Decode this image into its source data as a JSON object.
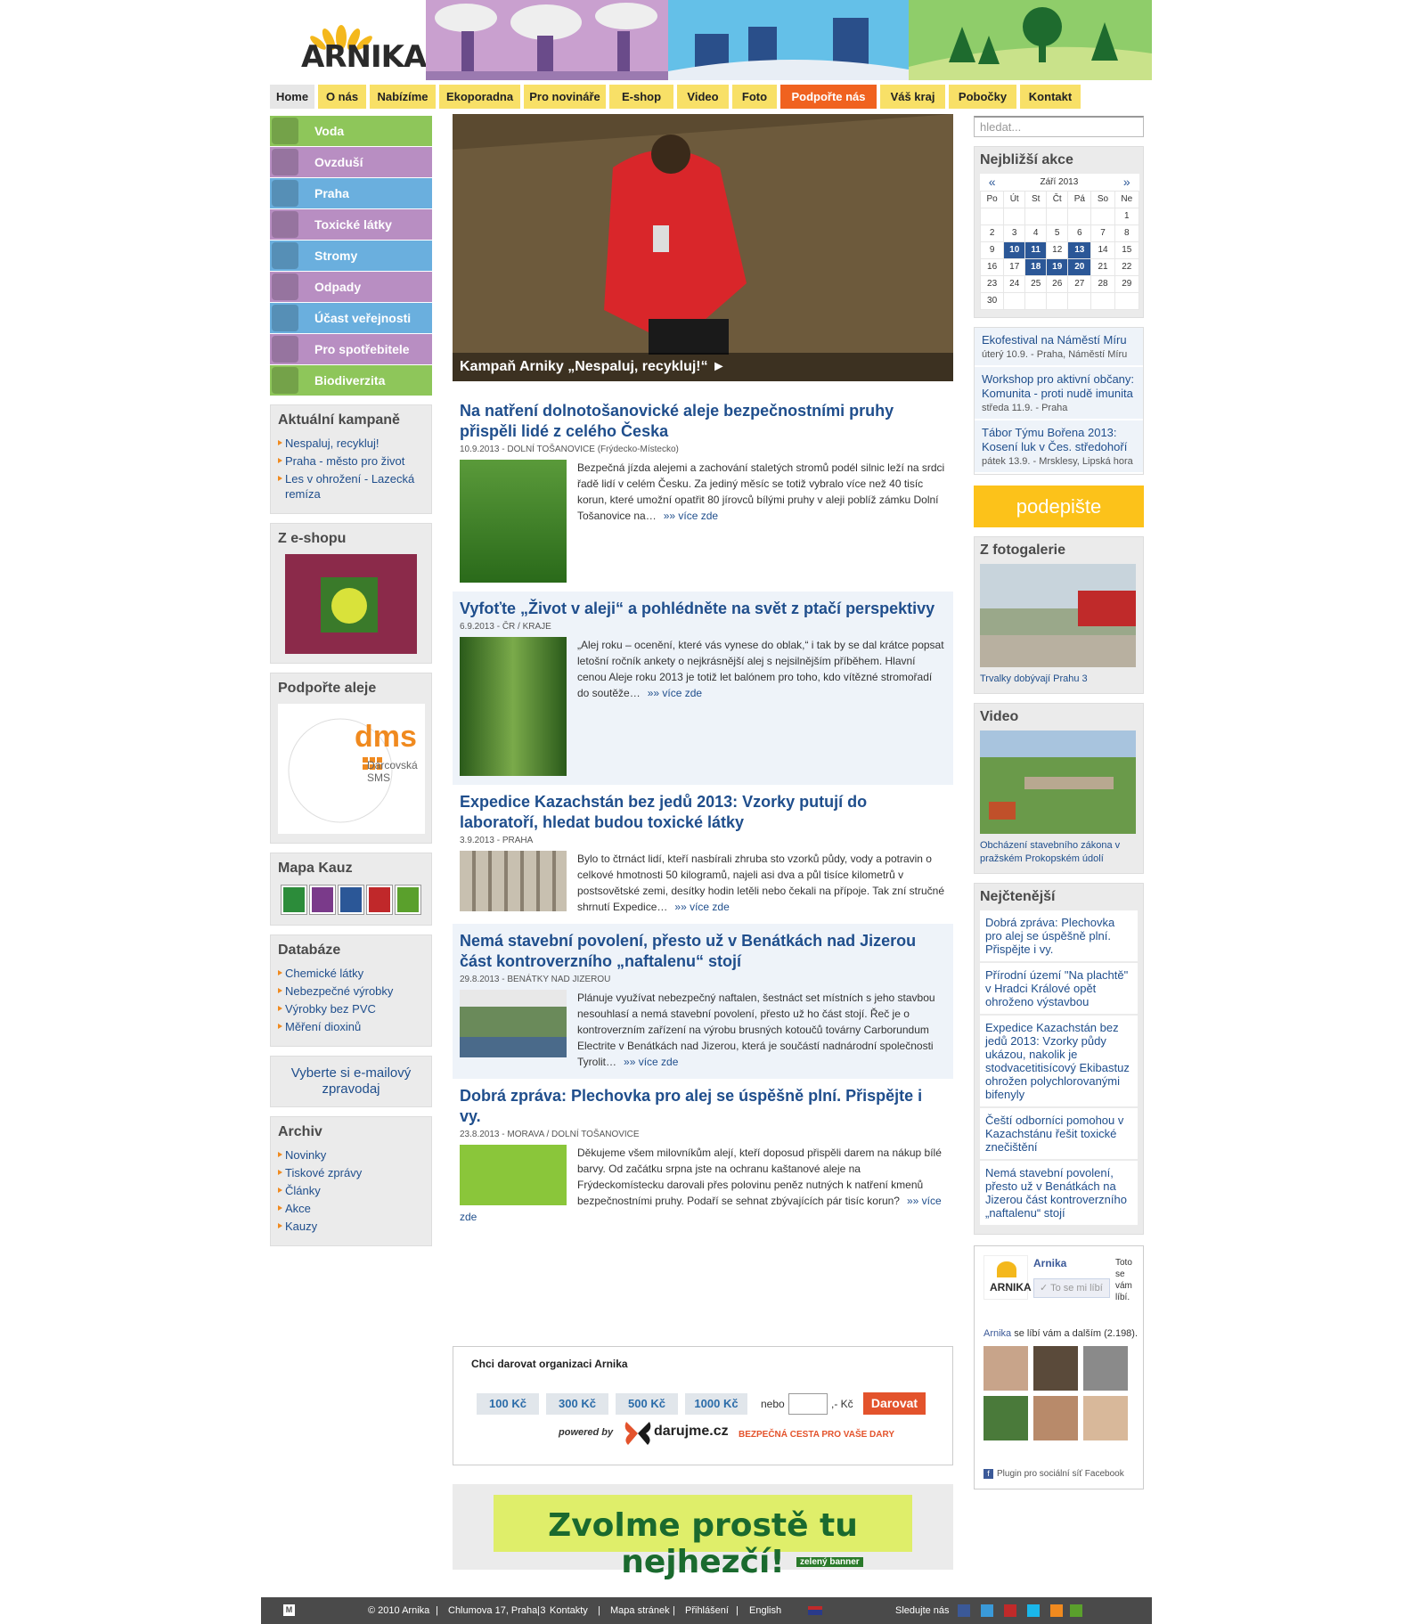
{
  "logo": {
    "text": "ARNIKA"
  },
  "nav": [
    "Home",
    "O nás",
    "Nabízíme",
    "Ekoporadna",
    "Pro novináře",
    "E-shop",
    "Video",
    "Foto",
    "Podpořte nás",
    "Váš kraj",
    "Pobočky",
    "Kontakt"
  ],
  "categories": [
    {
      "label": "Voda",
      "color": "#8ec65a",
      "icon": "water-icon"
    },
    {
      "label": "Ovzduší",
      "color": "#b88ec2",
      "icon": "chimney-icon"
    },
    {
      "label": "Praha",
      "color": "#6aafde",
      "icon": "city-icon"
    },
    {
      "label": "Toxické látky",
      "color": "#b88ec2",
      "icon": "toxic-icon"
    },
    {
      "label": "Stromy",
      "color": "#6aafde",
      "icon": "tree-icon"
    },
    {
      "label": "Odpady",
      "color": "#b88ec2",
      "icon": "recycle-icon"
    },
    {
      "label": "Účast veřejnosti",
      "color": "#6aafde",
      "icon": "people-icon"
    },
    {
      "label": "Pro spotřebitele",
      "color": "#b88ec2",
      "icon": "hand-icon"
    },
    {
      "label": "Biodiverzita",
      "color": "#8ec65a",
      "icon": "plant-icon"
    }
  ],
  "kampane": {
    "title": "Aktuální kampaně",
    "items": [
      "Nespaluj, recykluj!",
      "Praha - město pro život",
      "Les v ohrožení - Lazecká remíza"
    ]
  },
  "eshop": {
    "title": "Z e-shopu"
  },
  "aleje": {
    "title": "Podpořte aleje",
    "dms": "dms",
    "dms_sub1": "Dárcovská",
    "dms_sub2": "SMS"
  },
  "mapa": {
    "title": "Mapa Kauz"
  },
  "databaze": {
    "title": "Databáze",
    "items": [
      "Chemické látky",
      "Nebezpečné výrobky",
      "Výrobky bez PVC",
      "Měření dioxinů"
    ]
  },
  "zpravodaj": "Vyberte si e-mailový zpravodaj",
  "archiv": {
    "title": "Archiv",
    "items": [
      "Novinky",
      "Tiskové zprávy",
      "Články",
      "Akce",
      "Kauzy"
    ]
  },
  "hero": {
    "caption": "Kampaň Arniky „Nespaluj, recykluj!“ ►"
  },
  "articles": [
    {
      "title": "Na natření dolnotošanovické aleje bezpečnostními pruhy přispěli lidé z celého Česka",
      "date": "10.9.2013",
      "place": "DOLNÍ TOŠANOVICE (Frýdecko-Místecko)",
      "text": "Bezpečná jízda alejemi a zachování staletých stromů podél silnic leží na srdci řadě lidí v celém Česku. Za jediný měsíc se totiž vybralo více než 40 tisíc korun, které umožní opatřit 80 jírovců bílými pruhy v aleji poblíž zámku Dolní Tošanovice na…",
      "more": "»» více zde"
    },
    {
      "title": "Vyfoťte „Život v aleji“ a pohlédněte na svět z ptačí perspektivy",
      "date": "6.9.2013",
      "place": "ČR / KRAJE",
      "text": "„Alej roku – ocenění, které vás vynese do oblak,“ i tak by se dal krátce popsat letošní ročník ankety o nejkrásnější alej s nejsilnějším příběhem. Hlavní cenou Aleje roku 2013 je totiž let balónem pro toho, kdo vítězné stromořadí do soutěže…",
      "more": "»» více zde"
    },
    {
      "title": "Expedice Kazachstán bez jedů 2013: Vzorky putují do laboratoří, hledat budou toxické látky",
      "date": "3.9.2013",
      "place": "PRAHA",
      "text": "Bylo to čtrnáct lidí, kteří nasbírali zhruba sto vzorků půdy, vody a potravin o celkové hmotnosti 50 kilogramů, najeli asi dva a půl tisíce kilometrů v postsovětské zemi, desítky hodin letěli nebo čekali na přípoje. Tak zní stručné shrnutí Expedice…",
      "more": "»» více zde"
    },
    {
      "title": "Nemá stavební povolení, přesto už v Benátkách nad Jizerou část kontroverzního „naftalenu“ stojí",
      "date": "29.8.2013",
      "place": "BENÁTKY NAD JIZEROU",
      "text": "Plánuje využívat nebezpečný naftalen, šestnáct set místních s jeho stavbou nesouhlasí a nemá stavební povolení, přesto už ho část stojí. Řeč je o kontroverzním zařízení na výrobu brusných kotoučů továrny Carborundum Electrite v Benátkách nad Jizerou, která je součástí nadnárodní společnosti Tyrolit…",
      "more": "»» více zde"
    },
    {
      "title": "Dobrá zpráva: Plechovka pro alej se úspěšně plní. Přispějte i vy.",
      "date": "23.8.2013",
      "place": "MORAVA / DOLNÍ TOŠANOVICE",
      "text": "Děkujeme všem milovníkům alejí, kteří doposud přispěli darem na nákup bílé barvy. Od začátku srpna jste na ochranu kaštanové aleje na Frýdeckomístecku darovali přes polovinu peněz nutných k natření kmenů bezpečnostními pruhy. Podaří se sehnat zbývajících pár tisíc korun?",
      "more": "»» více zde"
    }
  ],
  "donate": {
    "title": "Chci darovat organizaci Arnika",
    "amounts": [
      "100 Kč",
      "300 Kč",
      "500 Kč",
      "1000 Kč"
    ],
    "nebo": "nebo",
    "kc": ",- Kč",
    "button": "Darovat",
    "powered": "powered by",
    "darujme": "darujme.cz",
    "bezpecna": "BEZPEČNÁ CESTA PRO VAŠE DARY"
  },
  "zvolme": {
    "text": "Zvolme prostě tu nejhezčí!",
    "banner": "zelený banner"
  },
  "search": {
    "placeholder": "hledat..."
  },
  "akce": {
    "title": "Nejbližší akce",
    "month": "Září 2013",
    "prev": "«",
    "next": "»",
    "days": [
      "Po",
      "Út",
      "St",
      "Čt",
      "Pá",
      "So",
      "Ne"
    ],
    "weeks": [
      [
        "",
        "",
        "",
        "",
        "",
        "",
        "1"
      ],
      [
        "2",
        "3",
        "4",
        "5",
        "6",
        "7",
        "8"
      ],
      [
        "9",
        "10",
        "11",
        "12",
        "13",
        "14",
        "15"
      ],
      [
        "16",
        "17",
        "18",
        "19",
        "20",
        "21",
        "22"
      ],
      [
        "23",
        "24",
        "25",
        "26",
        "27",
        "28",
        "29"
      ],
      [
        "30",
        "",
        "",
        "",
        "",
        "",
        ""
      ]
    ],
    "highlighted": [
      "10",
      "11",
      "13",
      "18",
      "19",
      "20"
    ]
  },
  "events": [
    {
      "title": "Ekofestival na Náměstí Míru",
      "date": "úterý 10.9.",
      "place": "Praha, Náměstí Míru"
    },
    {
      "title": "Workshop pro aktivní občany: Komunita - proti nudě imunita",
      "date": "středa 11.9.",
      "place": "Praha"
    },
    {
      "title": "Tábor Týmu Bořena 2013: Kosení luk v Čes. středohoří",
      "date": "pátek 13.9.",
      "place": "Mrsklesy, Lipská hora"
    }
  ],
  "podepiste": "podepište",
  "fotogalerie": {
    "title": "Z fotogalerie",
    "caption": "Trvalky dobývají Prahu 3"
  },
  "video": {
    "title": "Video",
    "caption": "Obcházení stavebního zákona v pražském Prokopském údolí"
  },
  "nejctenejsi": {
    "title": "Nejčtenější",
    "items": [
      "Dobrá zpráva: Plechovka pro alej se úspěšně plní. Přispějte i vy.",
      "Přírodní území \"Na plachtě\" v Hradci Králové opět ohroženo výstavbou",
      "Expedice Kazachstán bez jedů 2013: Vzorky půdy ukázou, nakolik je stodvacetitisícový Ekibastuz ohrožen polychlorovanými bifenyly",
      "Čeští odborníci pomohou v Kazachstánu řešit toxické znečištění",
      "Nemá stavební povolení, přesto už v Benátkách na Jizerou část kontroverzního „naftalenu“ stojí"
    ]
  },
  "facebook": {
    "name": "Arnika",
    "like": "To se mi líbí",
    "side": "Toto se vám líbí.",
    "likes_prefix": "Arnika",
    "likes_text": " se líbí vám a dalším (2.198).",
    "plugin": "Plugin pro sociální síť Facebook"
  },
  "footer": {
    "copyright": "© 2010 Arnika",
    "address": "Chlumova 17, Praha 3",
    "kontakty": "Kontakty",
    "mapa": "Mapa stránek",
    "prihlaseni": "Přihlášení",
    "english": "English",
    "sledujte": "Sledujte nás"
  },
  "colors": {
    "accent_blue": "#1f4e8c",
    "nav_yellow": "#f8e067",
    "nav_orange": "#f0621f"
  }
}
